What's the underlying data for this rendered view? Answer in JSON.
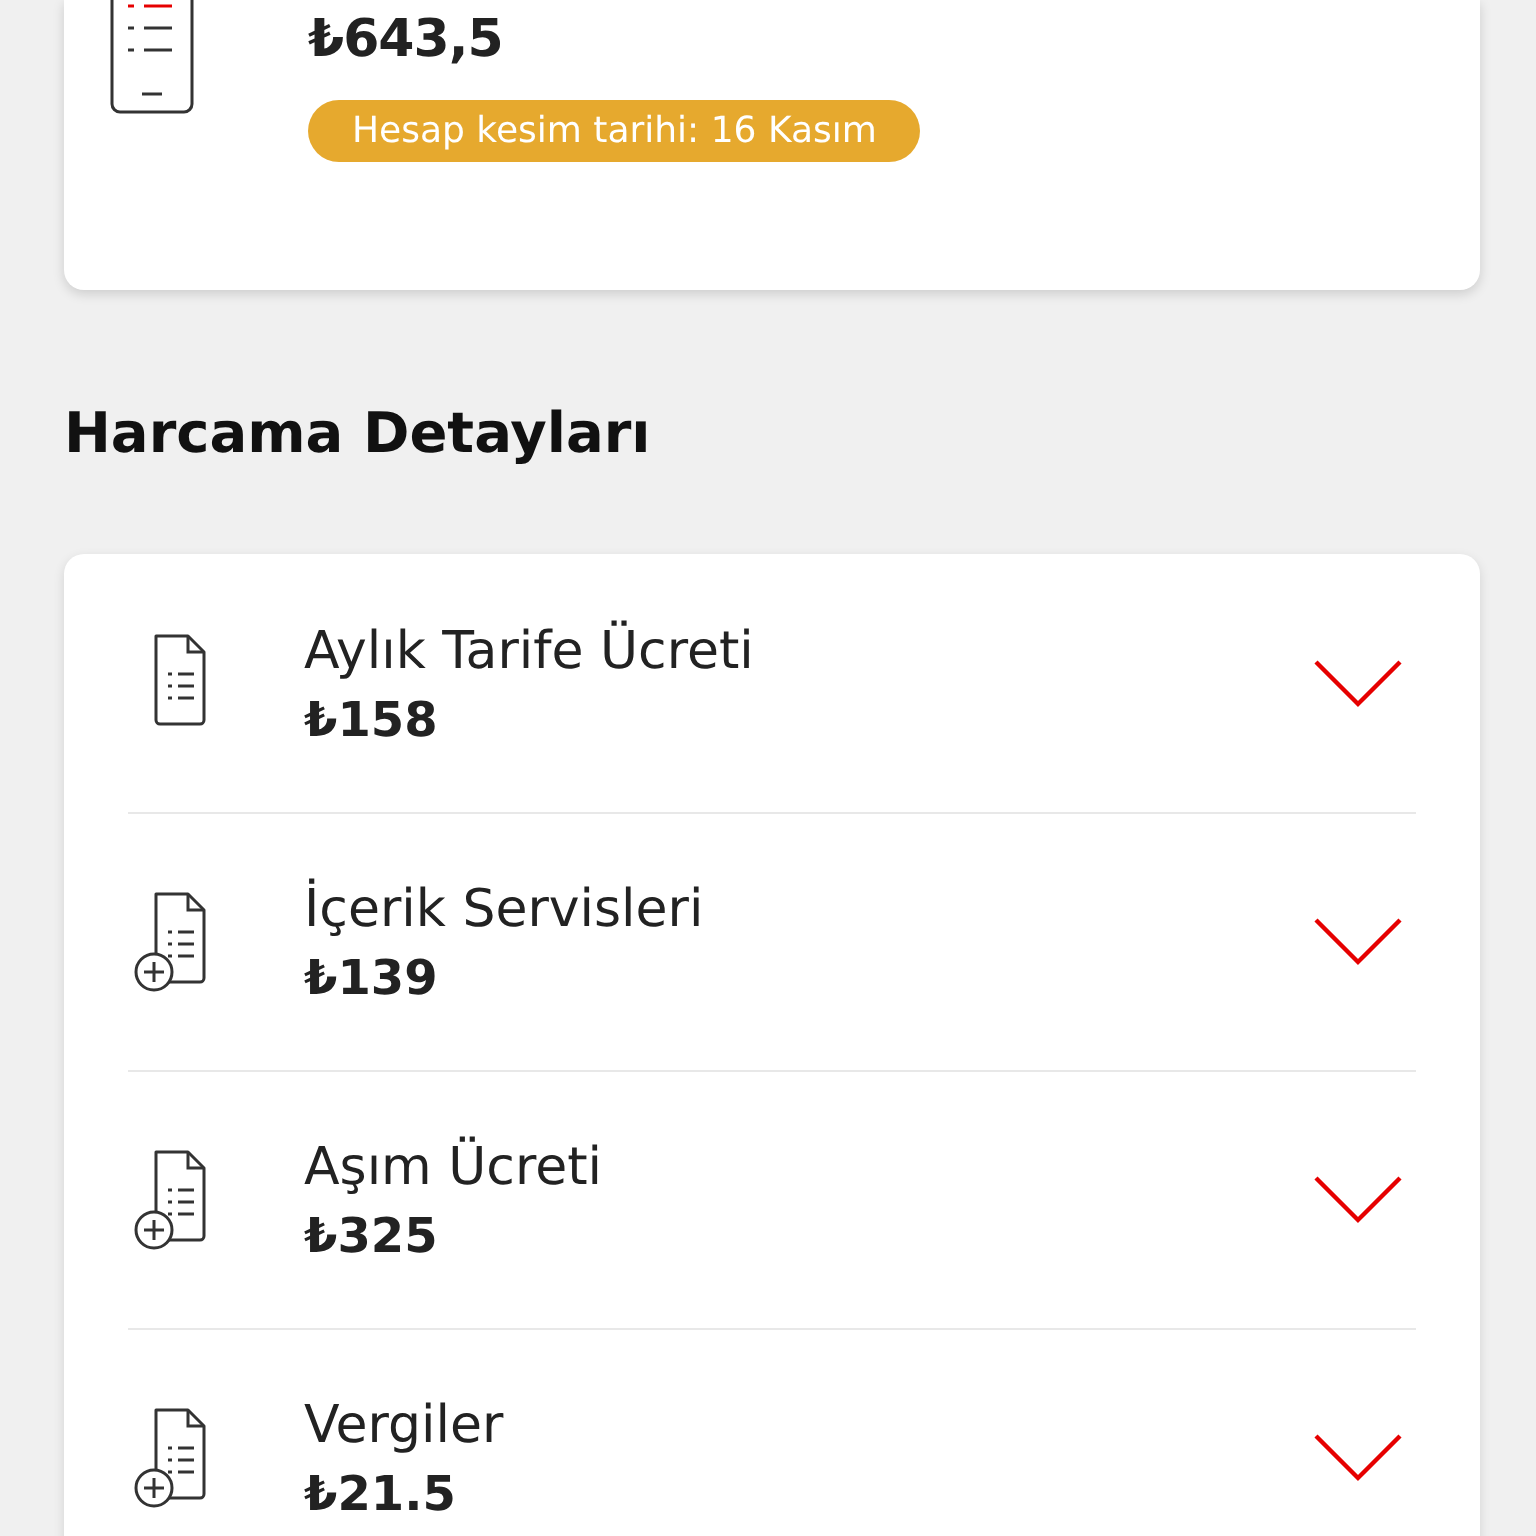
{
  "bill": {
    "amount": "₺643,5",
    "due_badge": "Hesap kesim tarihi: 16 Kasım"
  },
  "section_title": "Harcama Detayları",
  "items": [
    {
      "kind": "document",
      "title": "Aylık Tarife Ücreti",
      "amount": "₺158",
      "expanded": false
    },
    {
      "kind": "document-plus",
      "title": "İçerik Servisleri",
      "amount": "₺139",
      "expanded": false
    },
    {
      "kind": "document-plus",
      "title": "Aşım Ücreti",
      "amount": "₺325",
      "expanded": false
    },
    {
      "kind": "document-plus",
      "title": "Vergiler",
      "amount": "₺21.5",
      "expanded": false
    }
  ]
}
